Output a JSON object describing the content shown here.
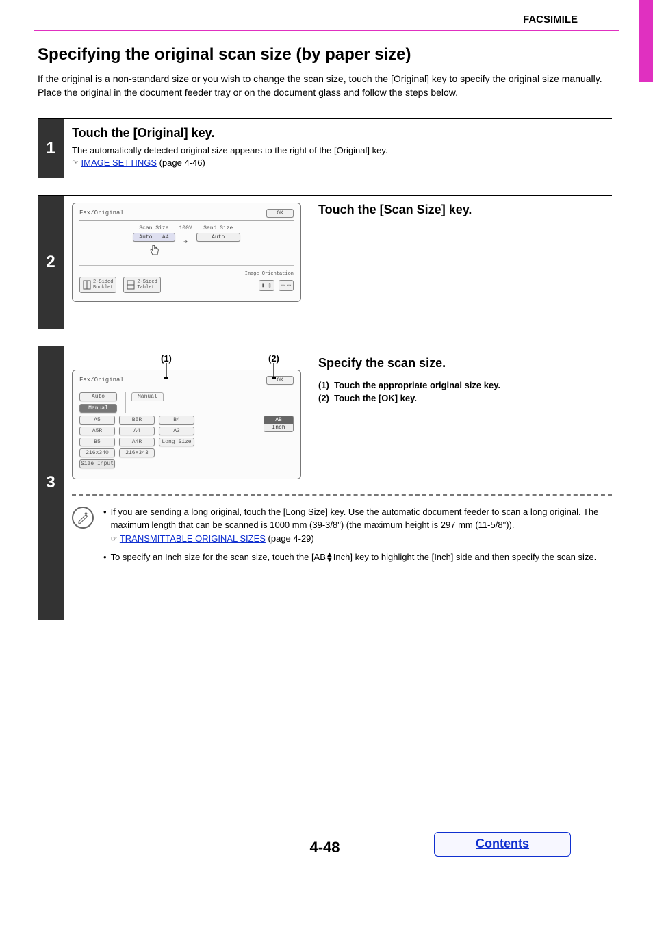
{
  "header": {
    "section": "FACSIMILE"
  },
  "title": "Specifying the original scan size (by paper size)",
  "intro": "If the original is a non-standard size or you wish to change the scan size, touch the [Original] key to specify the original size manually. Place the original in the document feeder tray or on the document glass and follow the steps below.",
  "step1": {
    "num": "1",
    "heading": "Touch the [Original] key.",
    "body": "The automatically detected original size appears to the right of the [Original] key.",
    "link": "IMAGE SETTINGS",
    "link_suffix": " (page 4-46)"
  },
  "step2": {
    "num": "2",
    "heading": "Touch the [Scan Size] key.",
    "panel": {
      "title": "Fax/Original",
      "ok": "OK",
      "scan_label": "Scan Size",
      "send_label": "Send Size",
      "pct": "100%",
      "auto": "Auto",
      "a4": "A4",
      "orientation_label": "Image Orientation",
      "btn_booklet": "2-Sided\nBooklet",
      "btn_tablet": "2-Sided\nTablet"
    }
  },
  "step3": {
    "num": "3",
    "heading": "Specify the scan size.",
    "callout1": "(1)",
    "callout2": "(2)",
    "instr1_num": "(1)",
    "instr1": "Touch the appropriate original size key.",
    "instr2_num": "(2)",
    "instr2": "Touch the [OK] key.",
    "panel": {
      "title": "Fax/Original",
      "ok": "OK",
      "auto": "Auto",
      "manual": "Manual",
      "manual_tab": "Manual",
      "sizes_r1": [
        "A5",
        "B5R",
        "B4"
      ],
      "sizes_r2": [
        "A5R",
        "A4",
        "A3"
      ],
      "sizes_r3": [
        "B5",
        "A4R",
        "Long Size"
      ],
      "sizes_r4": [
        "216x340",
        "216x343"
      ],
      "size_input": "Size Input",
      "ab": "AB",
      "inch": "Inch"
    },
    "note1a": "If you are sending a long original, touch the [Long Size] key. Use the automatic document feeder to scan a long original. The maximum length that can be scanned is 1000 mm (39-3/8\") (the maximum height is 297 mm (11-5/8\")).",
    "note1_link": "TRANSMITTABLE ORIGINAL SIZES",
    "note1_link_suffix": " (page 4-29)",
    "note2a": "To specify an Inch size for the scan size, touch the [AB",
    "note2b": "Inch] key to highlight the [Inch] side and then specify the scan size."
  },
  "page_number": "4-48",
  "contents_label": "Contents"
}
